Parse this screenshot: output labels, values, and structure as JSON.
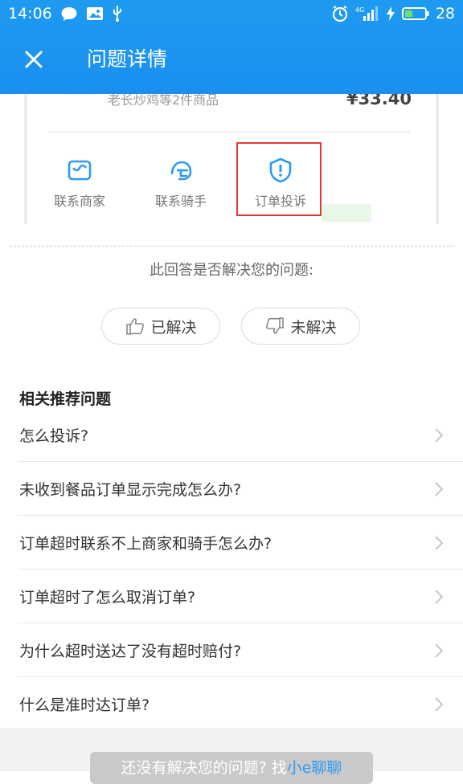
{
  "status_bar": {
    "time": "14:06",
    "battery": "28",
    "network": "4G"
  },
  "app_bar": {
    "title": "问题详情"
  },
  "screenshot": {
    "goods_text": "老长炒鸡等2件商品",
    "price": "¥33.40",
    "actions": [
      {
        "label": "联系商家"
      },
      {
        "label": "联系骑手"
      },
      {
        "label": "订单投诉"
      }
    ]
  },
  "feedback": {
    "question": "此回答是否解决您的问题:",
    "resolved_label": "已解决",
    "unresolved_label": "未解决"
  },
  "related": {
    "title": "相关推荐问题",
    "items": [
      {
        "label": "怎么投诉?"
      },
      {
        "label": "未收到餐品订单显示完成怎么办?"
      },
      {
        "label": "订单超时联系不上商家和骑手怎么办?"
      },
      {
        "label": "订单超时了怎么取消订单?"
      },
      {
        "label": "为什么超时送达了没有超时赔付?"
      },
      {
        "label": "什么是准时达订单?"
      }
    ]
  },
  "bottom": {
    "prefix": "还没有解决您的问题? 找",
    "link": "小e聊聊"
  },
  "colors": {
    "accent": "#1a8ff0",
    "highlight_border": "#e53935",
    "link": "#2b9bf4"
  }
}
